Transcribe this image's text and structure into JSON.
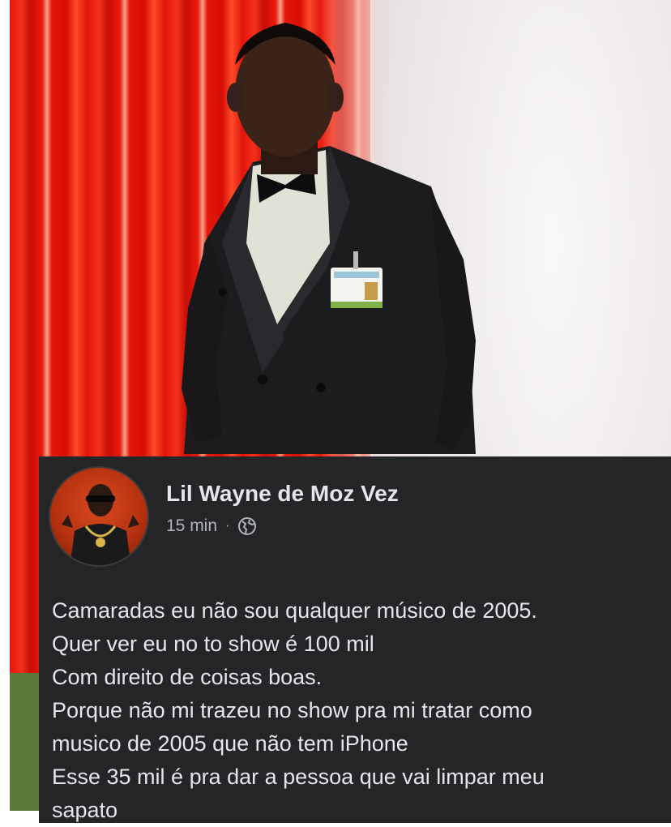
{
  "post": {
    "author": "Lil Wayne de Moz Vez",
    "time": "15 min",
    "separator": "·",
    "privacy_icon": "globe-icon",
    "lines": [
      "Camaradas eu não sou qualquer músico de 2005.",
      "Quer ver eu no to show é 100 mil",
      "Com direito de coisas boas.",
      "Porque não mi trazeu no show pra mi tratar como",
      "musico de 2005 que não tem iPhone",
      "Esse 35 mil é pra dar a pessoa que vai limpar meu",
      "sapato"
    ]
  },
  "colors": {
    "card_bg": "#242526",
    "text_primary": "#e4e6eb",
    "text_secondary": "#b0b3b8",
    "curtain_red": "#e8130c"
  }
}
